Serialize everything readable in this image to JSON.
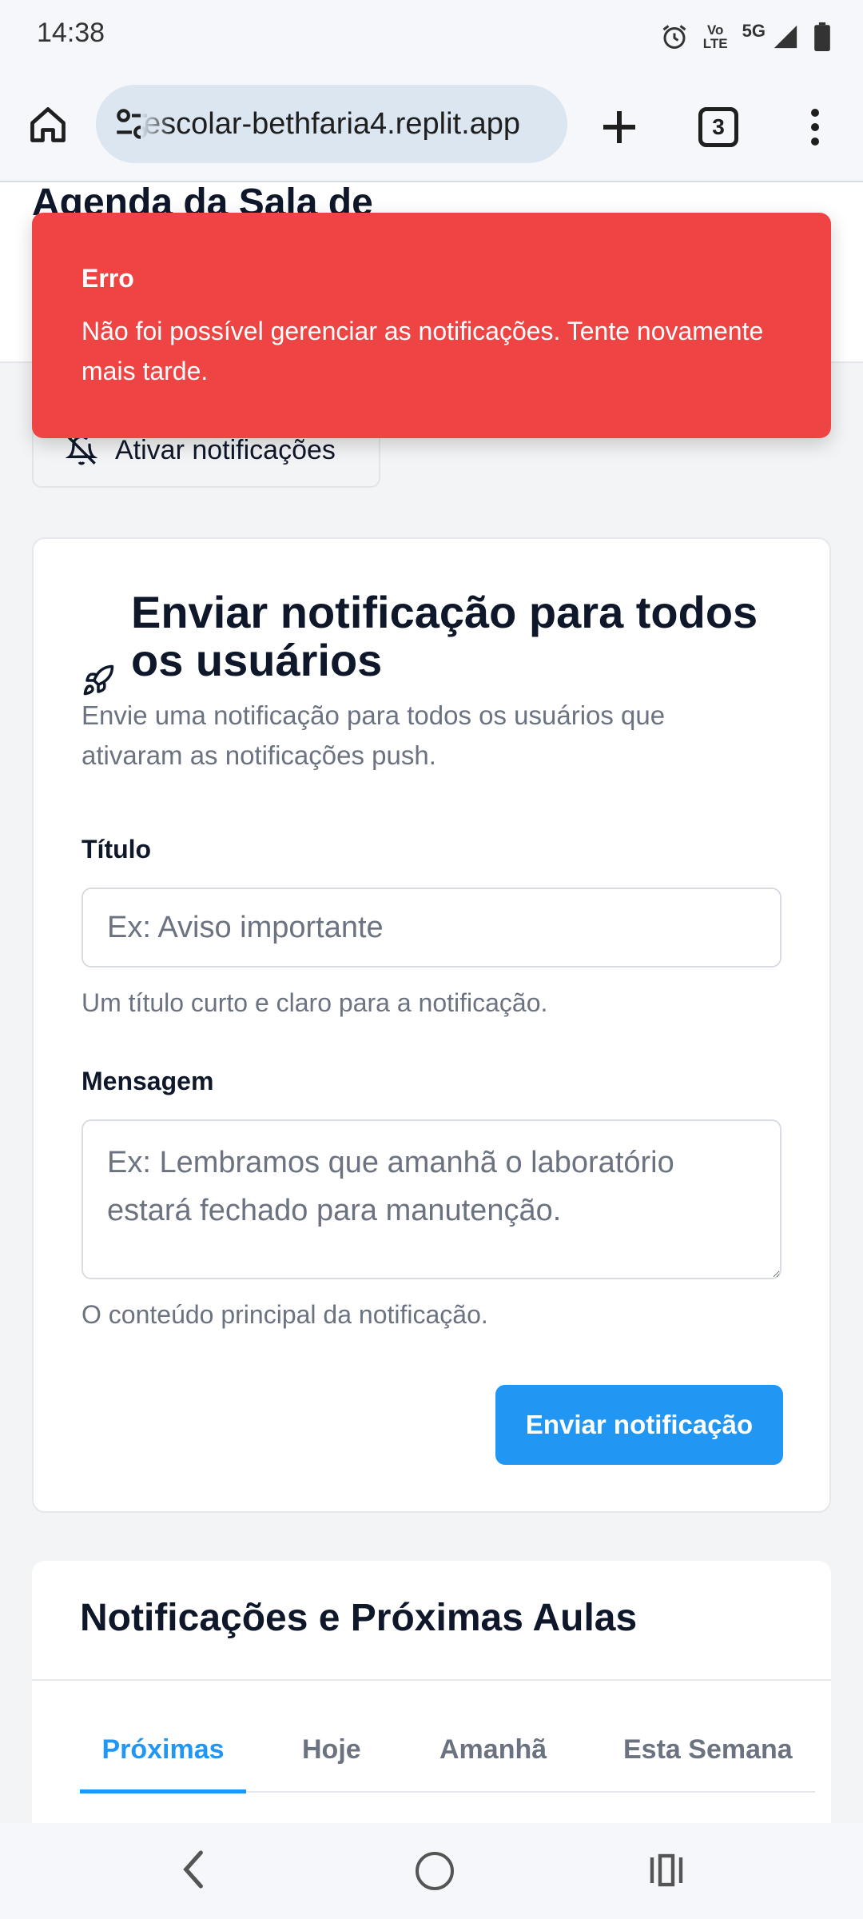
{
  "status_bar": {
    "time": "14:38",
    "network_top": "Vo",
    "network_mid": "LTE",
    "network_type": "5G",
    "icons": [
      "alarm-icon",
      "volte-icon",
      "signal-icon",
      "battery-icon"
    ]
  },
  "browser": {
    "url": "escolar-bethfaria4.replit.app",
    "tab_count": "3",
    "icons": [
      "home-icon",
      "site-settings-icon",
      "new-tab-icon",
      "tabs-icon",
      "more-vert-icon"
    ]
  },
  "page": {
    "title": "Agenda da Sala de",
    "enable_notifications_label": "Ativar notificações"
  },
  "toast": {
    "title": "Erro",
    "message": "Não foi possível gerenciar as notificações. Tente novamente mais tarde.",
    "color": "#ef4444"
  },
  "send_card": {
    "title": "Enviar notificação para todos os usuários",
    "description": "Envie uma notificação para todos os usuários que ativaram as notificações push.",
    "title_field": {
      "label": "Título",
      "value": "",
      "placeholder": "Ex: Aviso importante",
      "helper": "Um título curto e claro para a notificação."
    },
    "message_field": {
      "label": "Mensagem",
      "value": "",
      "placeholder": "Ex: Lembramos que amanhã o laboratório estará fechado para manutenção.",
      "helper": "O conteúdo principal da notificação."
    },
    "submit_label": "Enviar notificação",
    "accent": "#2196f3"
  },
  "notifications": {
    "title": "Notificações e Próximas Aulas",
    "tabs": [
      {
        "label": "Próximas",
        "active": true
      },
      {
        "label": "Hoje",
        "active": false
      },
      {
        "label": "Amanhã",
        "active": false
      },
      {
        "label": "Esta Semana",
        "active": false
      }
    ]
  }
}
